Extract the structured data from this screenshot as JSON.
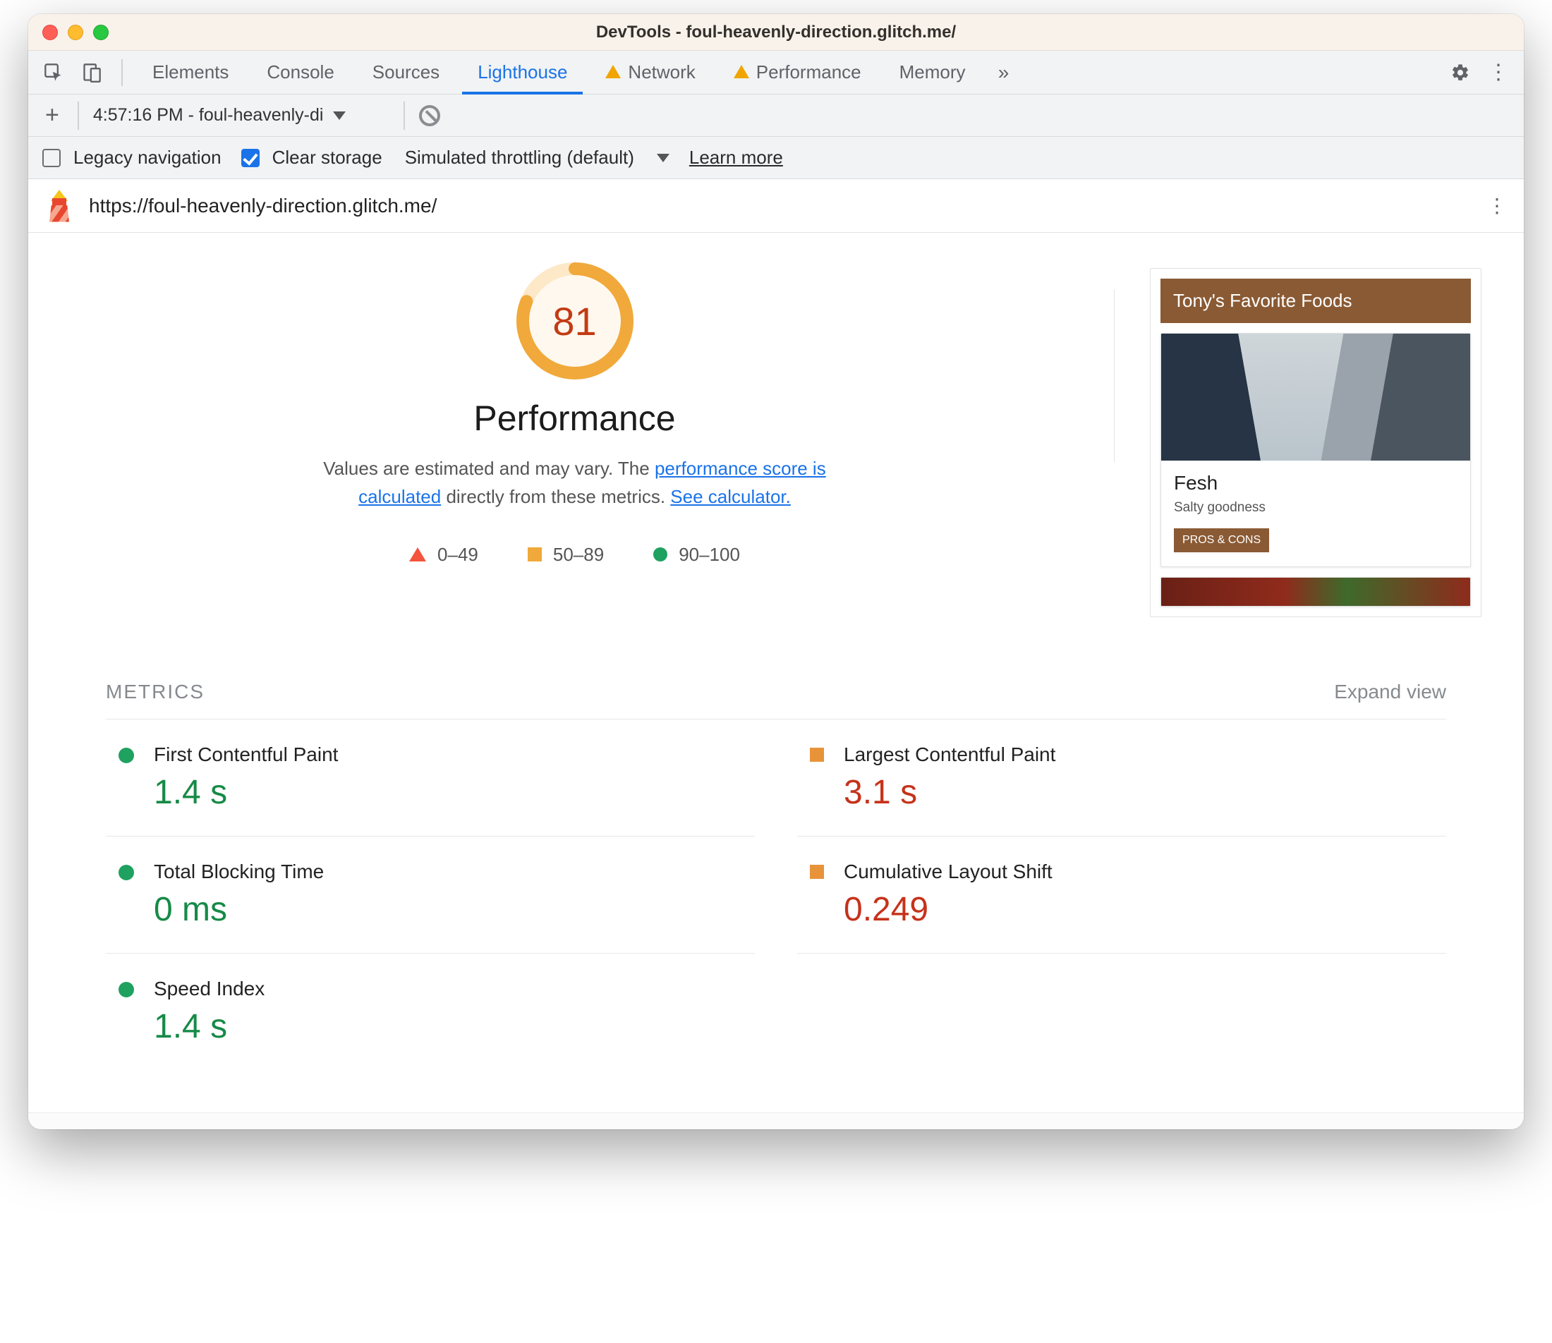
{
  "titlebar": {
    "title": "DevTools - foul-heavenly-direction.glitch.me/"
  },
  "tabs": {
    "items": [
      "Elements",
      "Console",
      "Sources",
      "Lighthouse",
      "Network",
      "Performance",
      "Memory"
    ],
    "active": "Lighthouse",
    "warn": [
      "Network",
      "Performance"
    ]
  },
  "toolbar2": {
    "report_label": "4:57:16 PM - foul-heavenly-di"
  },
  "options": {
    "legacy_label": "Legacy navigation",
    "clear_label": "Clear storage",
    "throttle_label": "Simulated throttling (default)",
    "learn_more": "Learn more"
  },
  "urlrow": {
    "url": "https://foul-heavenly-direction.glitch.me/"
  },
  "gauge": {
    "score": "81",
    "title": "Performance",
    "desc_a": "Values are estimated and may vary. The ",
    "link1": "performance score is calculated",
    "desc_b": " directly from these metrics. ",
    "link2": "See calculator."
  },
  "legend": {
    "r": "0–49",
    "o": "50–89",
    "g": "90–100"
  },
  "preview": {
    "header": "Tony's Favorite Foods",
    "card_title": "Fesh",
    "card_sub": "Salty goodness",
    "card_btn": "PROS & CONS"
  },
  "metrics": {
    "heading": "METRICS",
    "expand": "Expand view",
    "items": [
      {
        "label": "First Contentful Paint",
        "value": "1.4 s",
        "status": "green",
        "shape": "dot"
      },
      {
        "label": "Largest Contentful Paint",
        "value": "3.1 s",
        "status": "red",
        "shape": "square"
      },
      {
        "label": "Total Blocking Time",
        "value": "0 ms",
        "status": "green",
        "shape": "dot"
      },
      {
        "label": "Cumulative Layout Shift",
        "value": "0.249",
        "status": "red",
        "shape": "square"
      },
      {
        "label": "Speed Index",
        "value": "1.4 s",
        "status": "green",
        "shape": "dot"
      }
    ]
  }
}
